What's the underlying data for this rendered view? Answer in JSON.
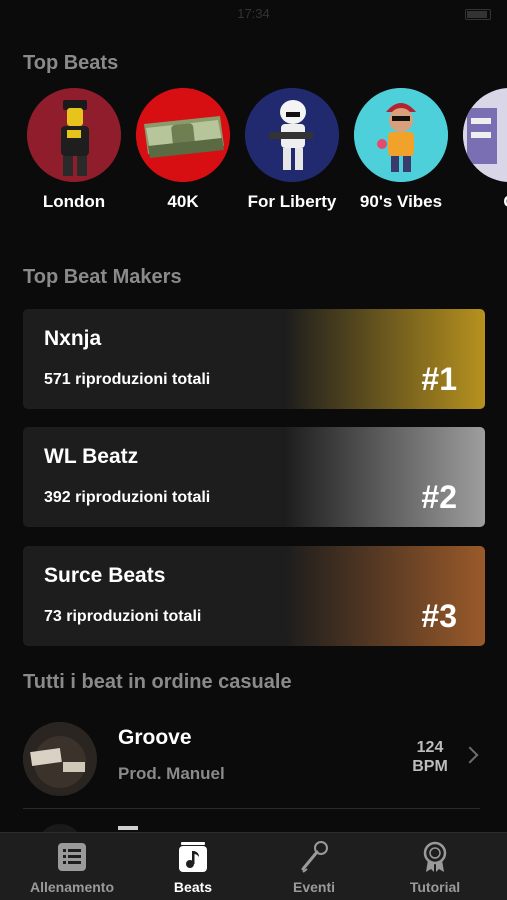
{
  "status": {
    "time": "17:34"
  },
  "top_beats": {
    "title": "Top Beats",
    "items": [
      {
        "name": "London"
      },
      {
        "name": "40K"
      },
      {
        "name": "For Liberty"
      },
      {
        "name": "90's Vibes"
      },
      {
        "name": "G"
      }
    ]
  },
  "top_makers": {
    "title": "Top Beat Makers",
    "items": [
      {
        "name": "Nxnja",
        "plays": "571 riproduzioni totali",
        "rank": "#1",
        "color": "#b7921f"
      },
      {
        "name": "WL Beatz",
        "plays": "392 riproduzioni totali",
        "rank": "#2",
        "color": "#9a9a9a"
      },
      {
        "name": "Surce Beats",
        "plays": "73 riproduzioni totali",
        "rank": "#3",
        "color": "#9a5a2a"
      }
    ]
  },
  "random": {
    "title": "Tutti i beat in ordine casuale",
    "items": [
      {
        "title": "Groove",
        "producer": "Prod. Manuel",
        "bpm_value": "124",
        "bpm_unit": "BPM"
      }
    ]
  },
  "tabbar": {
    "tabs": [
      {
        "label": "Allenamento",
        "icon": "list-icon"
      },
      {
        "label": "Beats",
        "icon": "music-note-icon"
      },
      {
        "label": "Eventi",
        "icon": "microphone-icon"
      },
      {
        "label": "Tutorial",
        "icon": "award-ribbon-icon"
      }
    ],
    "active": "Beats"
  }
}
